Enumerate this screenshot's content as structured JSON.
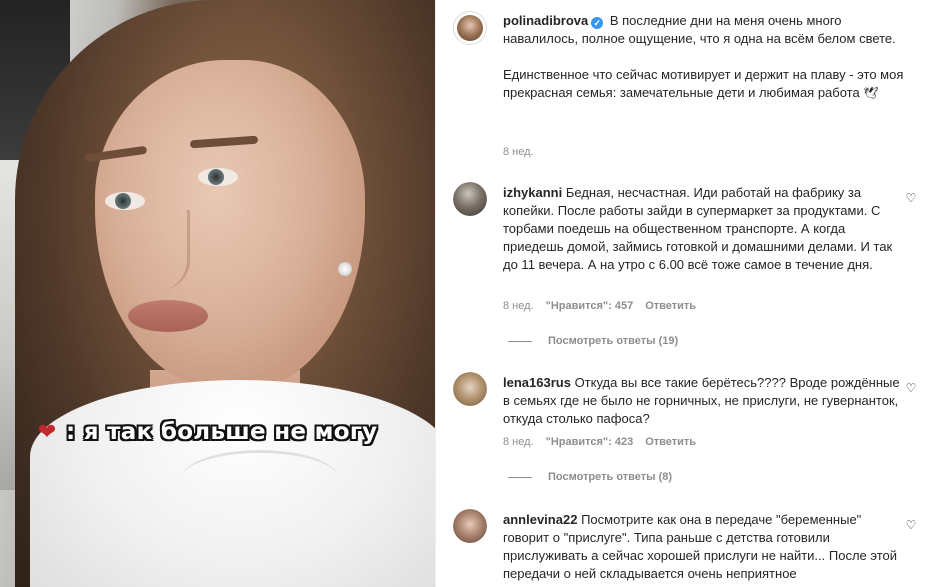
{
  "media": {
    "caption_emoji": "❤",
    "caption_text": ": я так больше не могу"
  },
  "post": {
    "username": "polinadibrova",
    "verified_mark": "✓",
    "text_p1": "В последние дни на меня очень много навалилось, полное ощущение, что я одна на всём белом свете.",
    "text_p2": "Единственное что сейчас мотивирует и держит на плаву - это моя прекрасная семья: замечательные дети и любимая работа",
    "text_emoji": "🕊",
    "time": "8 нед."
  },
  "comments": [
    {
      "username": "izhykanni",
      "text": "Бедная, несчастная. Иди работай на фабрику за копейки. После работы зайди в супермаркет за продуктами. С торбами поедешь на общественном транспорте. А когда приедешь домой, займись готовкой и домашними делами. И так до 11 вечера. А на утро с 6.00 всё тоже самое в течение дня.",
      "time": "8 нед.",
      "likes": "\"Нравится\": 457",
      "reply": "Ответить",
      "view_replies": "Посмотреть ответы (19)"
    },
    {
      "username": "lena163rus",
      "text": "Откуда вы все такие берётесь???? Вроде рождённые в семьях где не было не горничных, не прислуги, не гувернанток, откуда столько пафоса?",
      "time": "8 нед.",
      "likes": "\"Нравится\": 423",
      "reply": "Ответить",
      "view_replies": "Посмотреть ответы (8)"
    },
    {
      "username": "annlevina22",
      "text": "Посмотрите как она в передаче \"беременные\" говорит о \"прислуге\". Типа раньше с детства готовили прислуживать а сейчас хорошей прислуги не найти... После этой передачи о ней складывается очень неприятное"
    }
  ],
  "icons": {
    "heart": "♡"
  }
}
